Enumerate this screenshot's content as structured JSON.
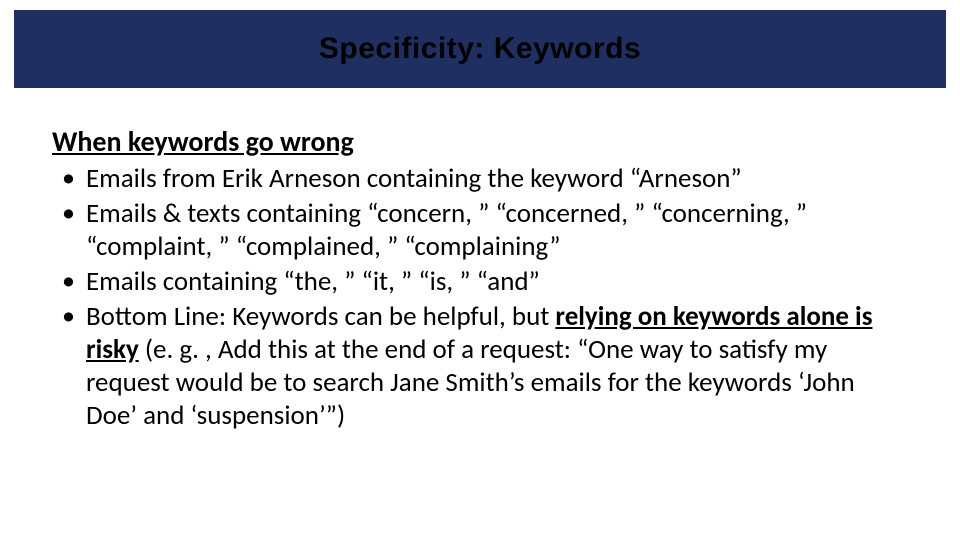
{
  "title": "Specificity: Keywords",
  "heading": "When keywords go wrong",
  "bullets": {
    "b1": "Emails from Erik Arneson containing the keyword “Arneson”",
    "b2": "Emails & texts containing “concern, ” “concerned, ” “concerning, ” “complaint, ” “complained, ” “complaining”",
    "b3": "Emails containing “the, ” “it, ” “is, ” “and”",
    "b4_pre": "Bottom Line: Keywords can be helpful, but ",
    "b4_underline": "relying on keywords alone is risky",
    "b4_post": " (e. g. , Add this at the end of a request: “One way to satisfy my request would be to search Jane Smith’s emails for the keywords ‘John Doe’ and ‘suspension’”)"
  }
}
